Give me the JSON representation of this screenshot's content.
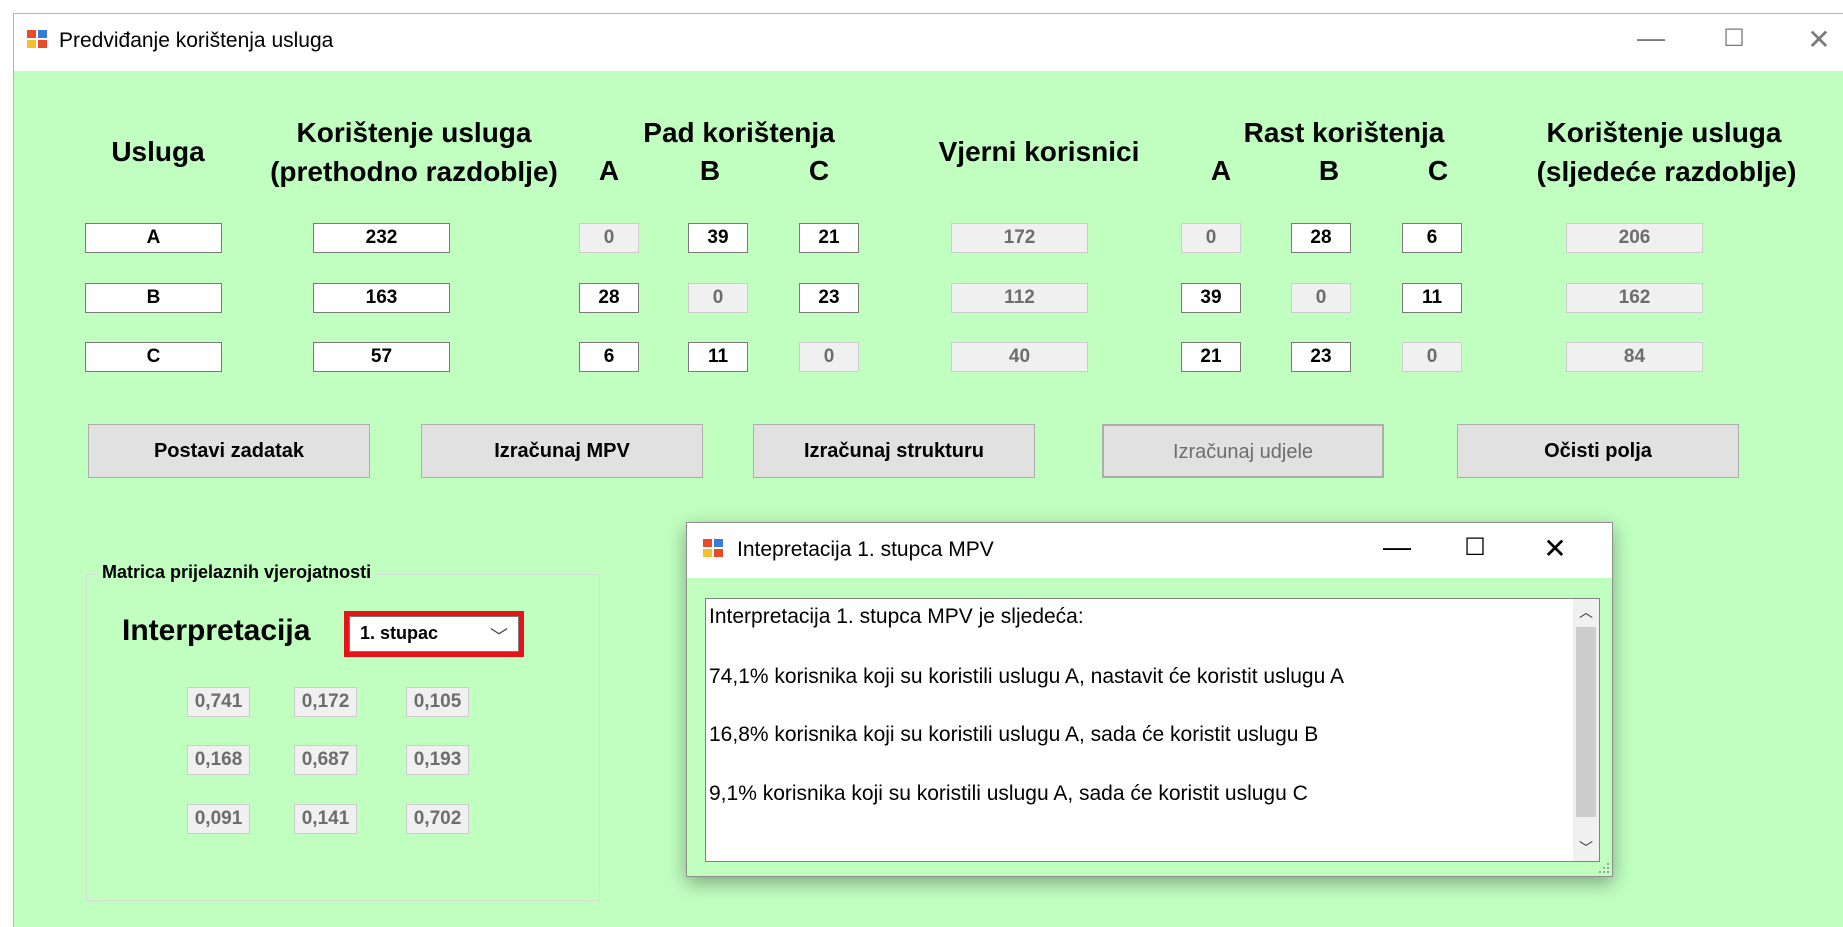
{
  "window": {
    "title": "Predviđanje korištenja usluga",
    "controls": [
      "—",
      "☐",
      "✕"
    ]
  },
  "headers": {
    "usluga": "Usluga",
    "koristenje_prev_line1": "Korištenje usluga",
    "koristenje_prev_line2": "(prethodno razdoblje)",
    "pad": "Pad korištenja",
    "vjerni": "Vjerni korisnici",
    "rast": "Rast korištenja",
    "koristenje_next_line1": "Korištenje usluga",
    "koristenje_next_line2": "(sljedeće razdoblje)",
    "sub": [
      "A",
      "B",
      "C"
    ]
  },
  "rows": [
    {
      "usluga": "A",
      "prev": "232",
      "pad": [
        "0",
        "39",
        "21"
      ],
      "vjerni": "172",
      "rast": [
        "0",
        "28",
        "6"
      ],
      "next": "206"
    },
    {
      "usluga": "B",
      "prev": "163",
      "pad": [
        "28",
        "0",
        "23"
      ],
      "vjerni": "112",
      "rast": [
        "39",
        "0",
        "11"
      ],
      "next": "162"
    },
    {
      "usluga": "C",
      "prev": "57",
      "pad": [
        "6",
        "11",
        "0"
      ],
      "vjerni": "40",
      "rast": [
        "21",
        "23",
        "0"
      ],
      "next": "84"
    }
  ],
  "buttons": {
    "postavi": "Postavi zadatak",
    "mpv": "Izračunaj MPV",
    "struktura": "Izračunaj strukturu",
    "udjele": "Izračunaj udjele",
    "ocisti": "Očisti polja"
  },
  "group": {
    "title": "Matrica prijelaznih vjerojatnosti",
    "interp_label": "Interpretacija",
    "combo_value": "1. stupac",
    "matrix": [
      [
        "0,741",
        "0,172",
        "0,105"
      ],
      [
        "0,168",
        "0,687",
        "0,193"
      ],
      [
        "0,091",
        "0,141",
        "0,702"
      ]
    ]
  },
  "dialog": {
    "title": "Intepretacija 1. stupca MPV",
    "controls": [
      "—",
      "☐",
      "✕"
    ],
    "lines": [
      "Interpretacija 1. stupca MPV je sljedeća:",
      "74,1% korisnika koji su koristili uslugu A, nastavit će koristit uslugu A",
      "16,8% korisnika koji su koristili uslugu A, sada će koristit uslugu B",
      "9,1% korisnika koji su koristili uslugu A, sada će koristit uslugu  C"
    ]
  },
  "colors": {
    "form_bg": "#c0ffc0",
    "highlight": "#e8131a",
    "button_bg": "#e1e1e1"
  }
}
